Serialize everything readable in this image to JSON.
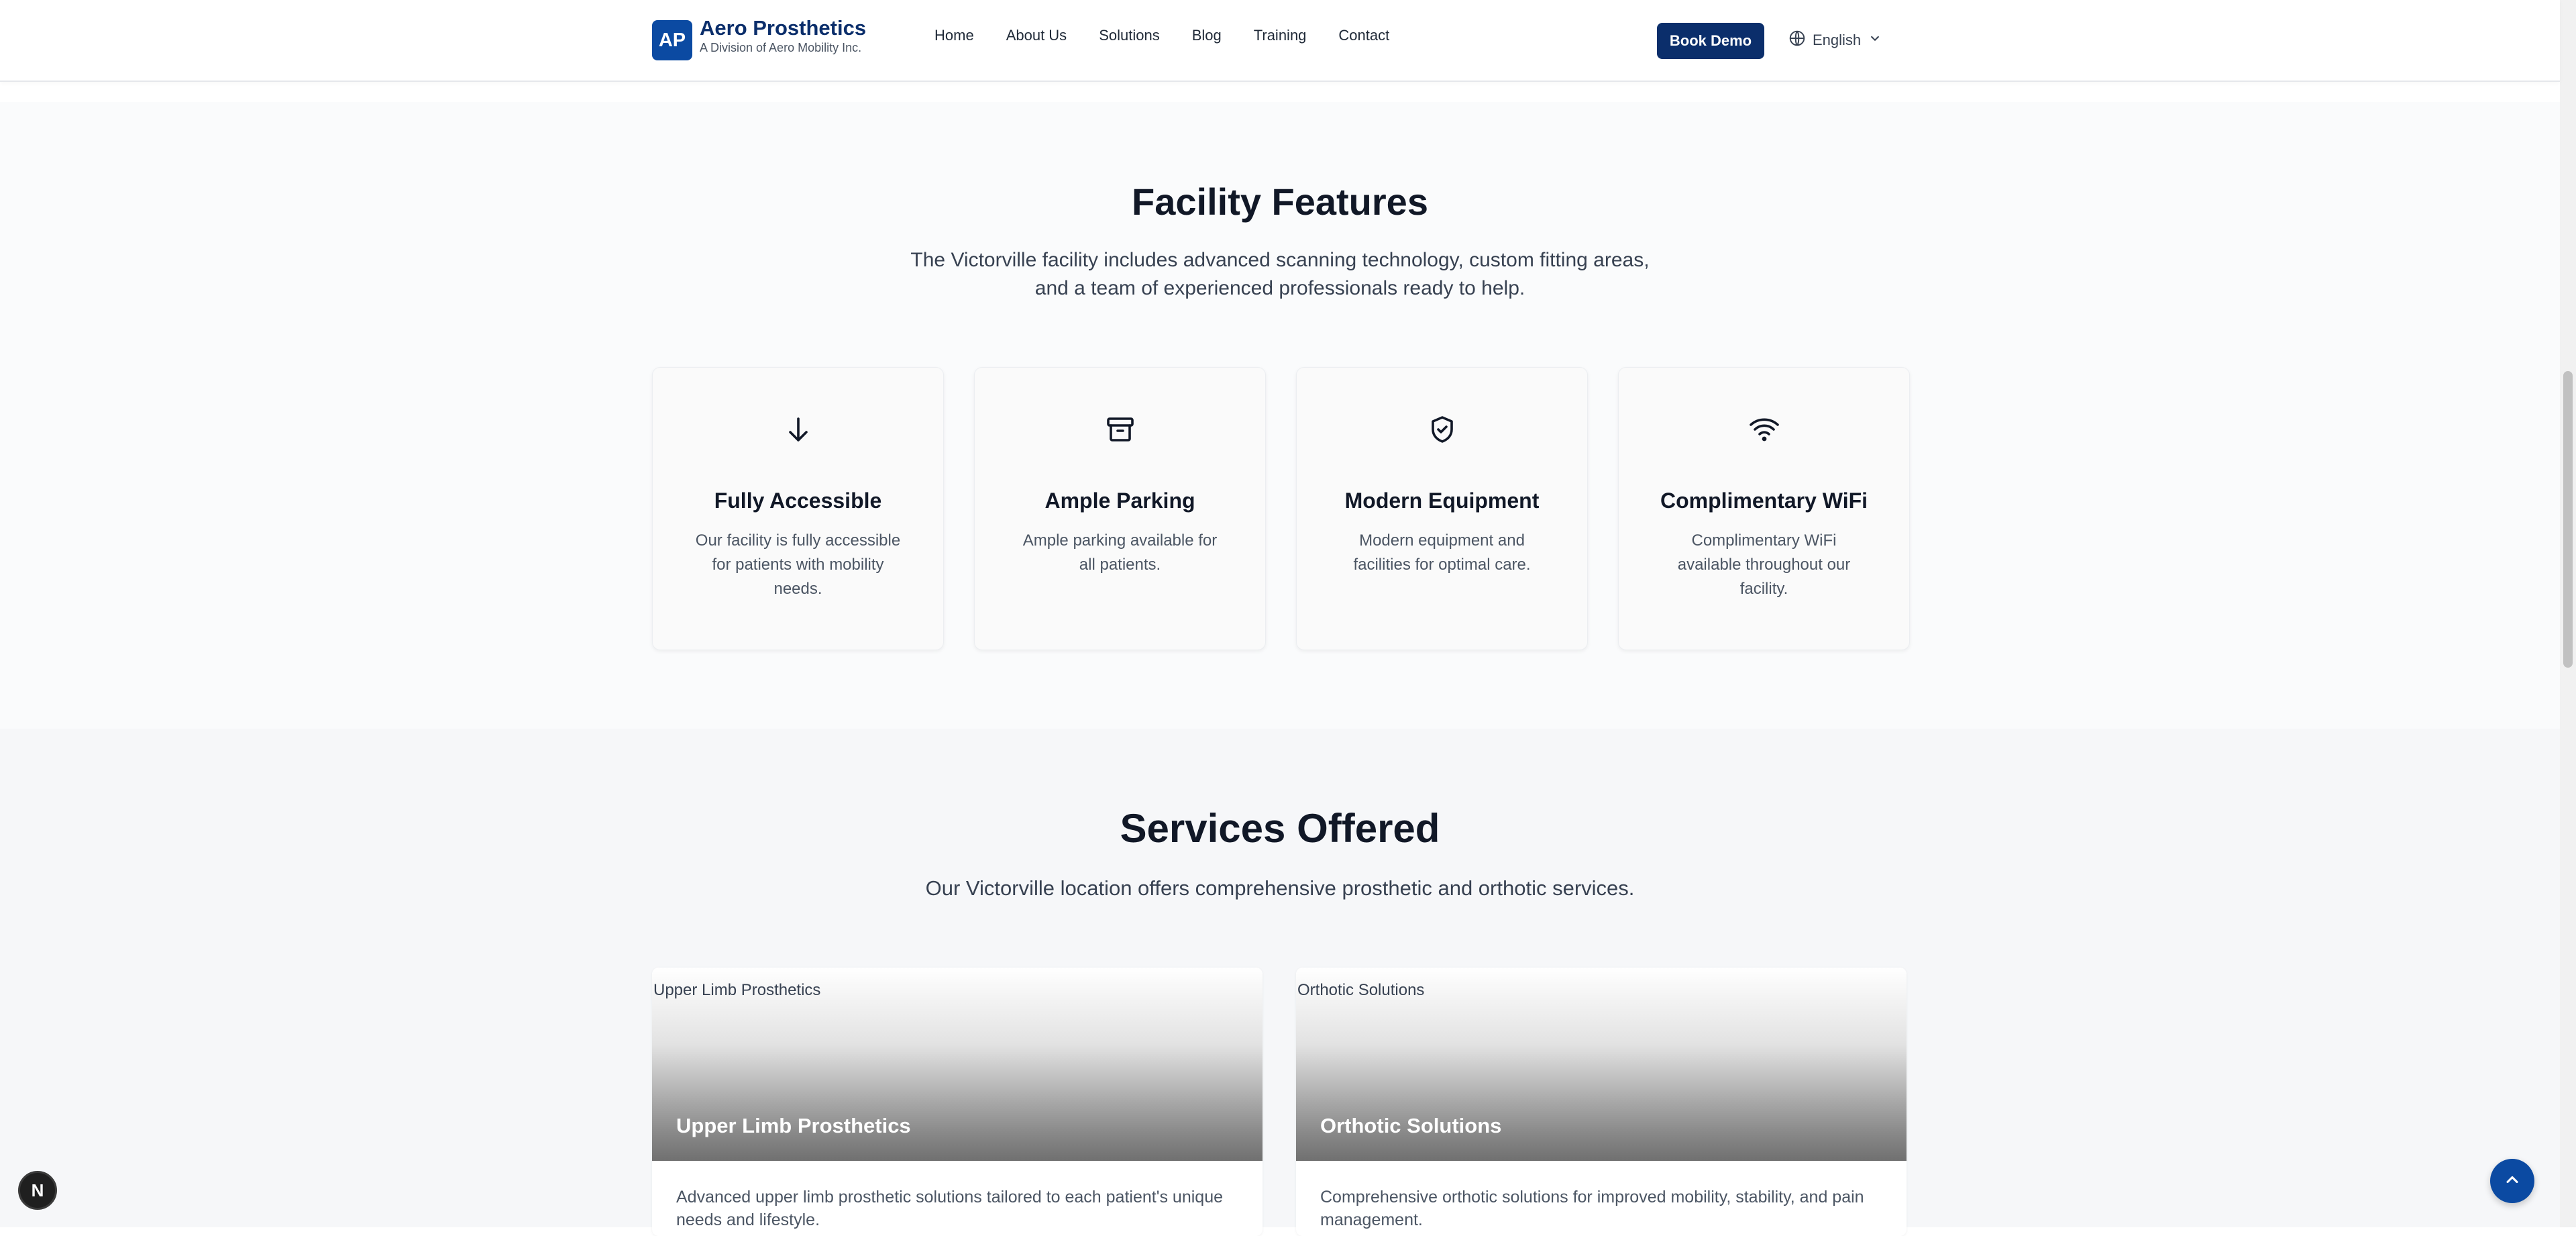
{
  "header": {
    "logo_text": "AP",
    "brand_name": "Aero Prosthetics",
    "brand_sub": "A Division of Aero Mobility Inc.",
    "nav": [
      "Home",
      "About Us",
      "Solutions",
      "Blog",
      "Training",
      "Contact"
    ],
    "cta": "Book Demo",
    "language": "English"
  },
  "features": {
    "title": "Facility Features",
    "description": "The Victorville facility includes advanced scanning technology, custom fitting areas, and a team of experienced professionals ready to help.",
    "cards": [
      {
        "icon": "arrow-down-icon",
        "title": "Fully Accessible",
        "desc": "Our facility is fully accessible for patients with mobility needs."
      },
      {
        "icon": "archive-icon",
        "title": "Ample Parking",
        "desc": "Ample parking available for all patients."
      },
      {
        "icon": "shield-check-icon",
        "title": "Modern Equipment",
        "desc": "Modern equipment and facilities for optimal care."
      },
      {
        "icon": "wifi-icon",
        "title": "Complimentary WiFi",
        "desc": "Complimentary WiFi available throughout our facility."
      }
    ]
  },
  "services": {
    "title": "Services Offered",
    "description": "Our Victorville location offers comprehensive prosthetic and orthotic services.",
    "cards": [
      {
        "img_alt": "Upper Limb Prosthetics",
        "title": "Upper Limb Prosthetics",
        "desc": "Advanced upper limb prosthetic solutions tailored to each patient's unique needs and lifestyle."
      },
      {
        "img_alt": "Orthotic Solutions",
        "title": "Orthotic Solutions",
        "desc": "Comprehensive orthotic solutions for improved mobility, stability, and pain management."
      }
    ]
  },
  "floating": {
    "dev_badge": "N"
  }
}
